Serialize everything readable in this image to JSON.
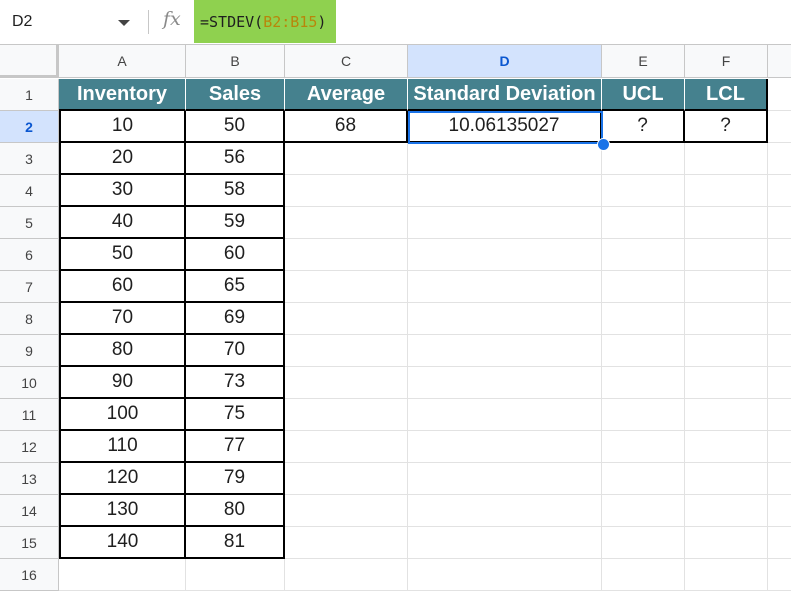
{
  "formula_bar": {
    "cell_ref": "D2",
    "formula_prefix": "=STDEV(",
    "formula_range": "B2:B15",
    "formula_suffix": ")",
    "fx_label": "fx"
  },
  "columns": [
    "A",
    "B",
    "C",
    "D",
    "E",
    "F"
  ],
  "rows": [
    "1",
    "2",
    "3",
    "4",
    "5",
    "6",
    "7",
    "8",
    "9",
    "10",
    "11",
    "12",
    "13",
    "14",
    "15",
    "16"
  ],
  "headers": {
    "a": "Inventory",
    "b": "Sales",
    "c": "Average",
    "d": "Standard Deviation",
    "e": "UCL",
    "f": "LCL"
  },
  "row2": {
    "c": "68",
    "d": "10.06135027",
    "e": "?",
    "f": "?"
  },
  "table": [
    {
      "a": "10",
      "b": "50"
    },
    {
      "a": "20",
      "b": "56"
    },
    {
      "a": "30",
      "b": "58"
    },
    {
      "a": "40",
      "b": "59"
    },
    {
      "a": "50",
      "b": "60"
    },
    {
      "a": "60",
      "b": "65"
    },
    {
      "a": "70",
      "b": "69"
    },
    {
      "a": "80",
      "b": "70"
    },
    {
      "a": "90",
      "b": "73"
    },
    {
      "a": "100",
      "b": "75"
    },
    {
      "a": "110",
      "b": "77"
    },
    {
      "a": "120",
      "b": "79"
    },
    {
      "a": "130",
      "b": "80"
    },
    {
      "a": "140",
      "b": "81"
    }
  ],
  "selected_cell": "D2",
  "colors": {
    "header_fill": "#45818e",
    "formula_highlight": "#8fd14f",
    "selection": "#1a73e8"
  }
}
